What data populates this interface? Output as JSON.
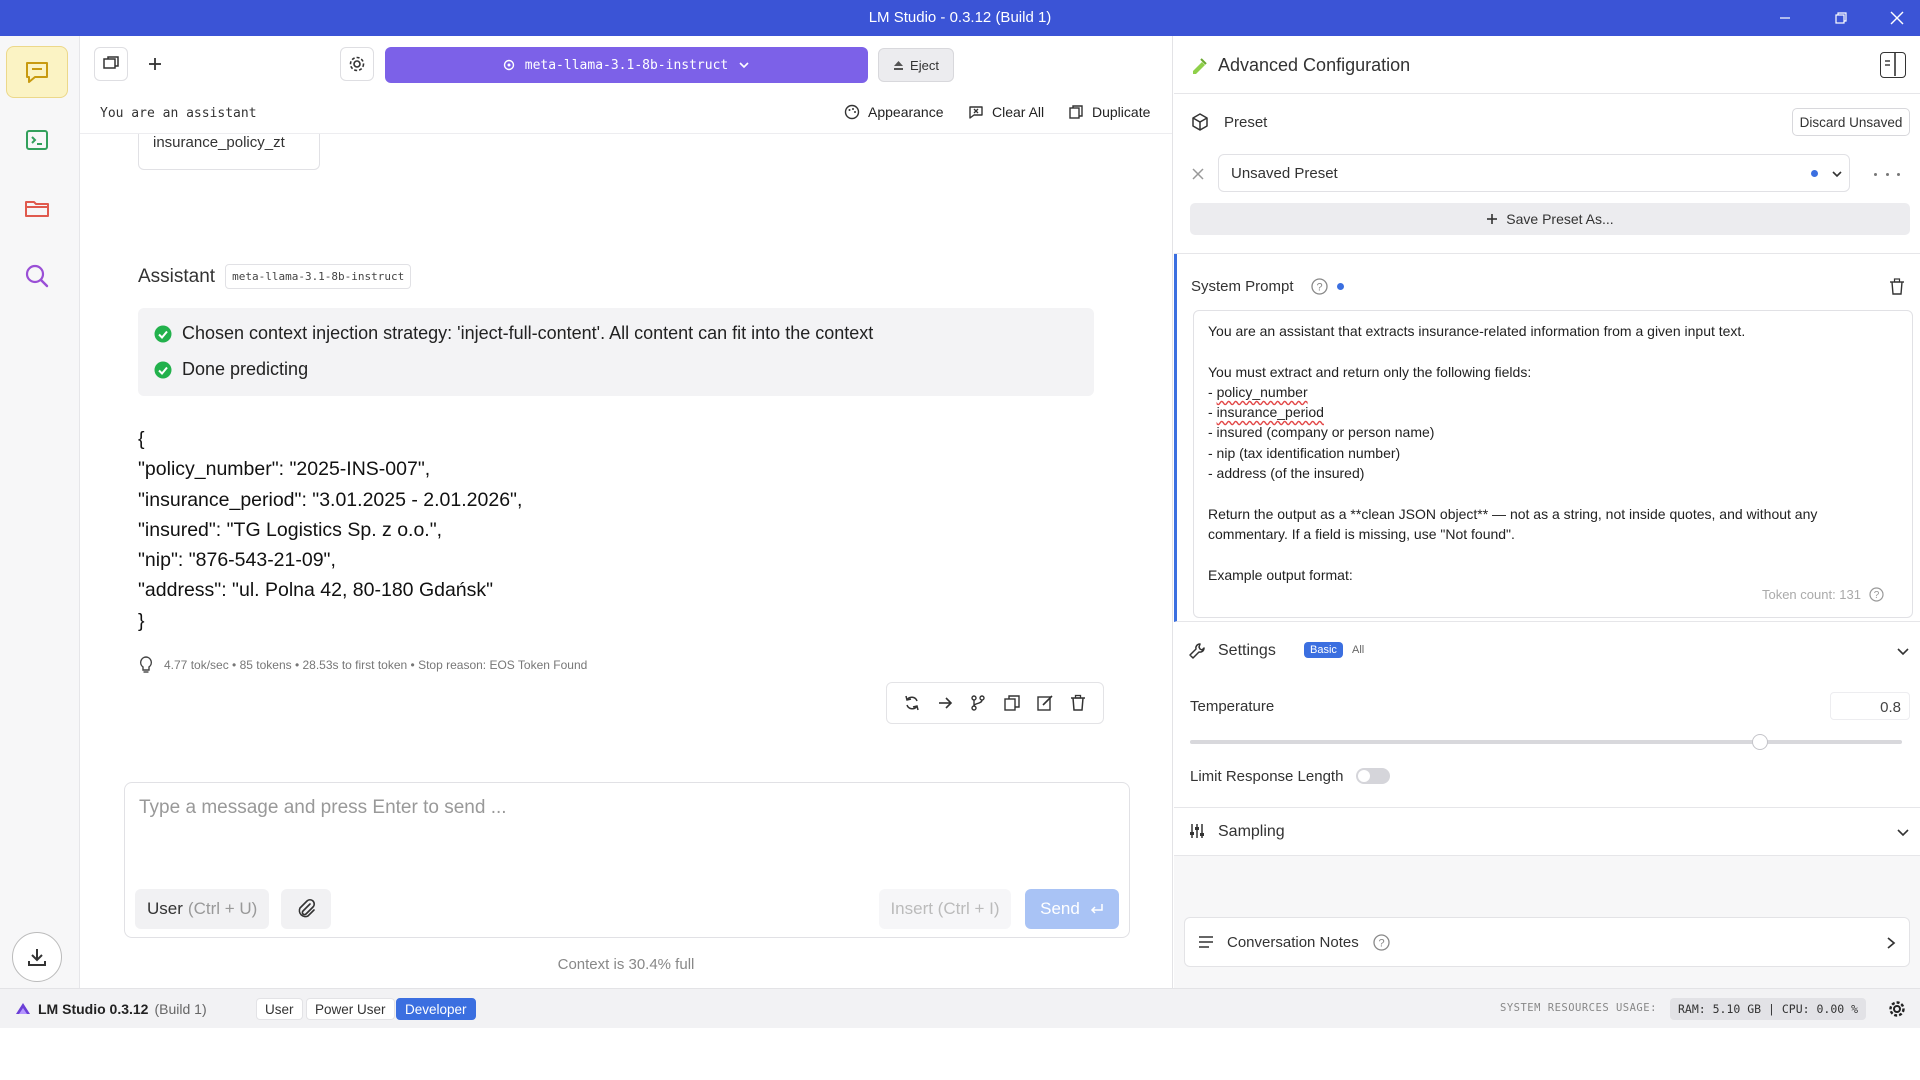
{
  "window": {
    "title": "LM Studio - 0.3.12 (Build 1)"
  },
  "chat": {
    "model": "meta-llama-3.1-8b-instruct",
    "eject_label": "Eject",
    "system_prompt_preview": "You are an assistant",
    "actions": {
      "appearance": "Appearance",
      "clear_all": "Clear All",
      "duplicate": "Duplicate"
    },
    "prev_attachment": "insurance_policy_zt",
    "assistant": {
      "label": "Assistant",
      "model_tag": "meta-llama-3.1-8b-instruct",
      "status": [
        "Chosen context injection strategy: 'inject-full-content'. All content can fit into the context",
        "Done predicting"
      ],
      "output_lines": [
        "{",
        "\"policy_number\": \"2025-INS-007\",",
        "\"insurance_period\": \"3.01.2025 - 2.01.2026\",",
        "\"insured\": \"TG Logistics Sp. z o.o.\",",
        "\"nip\": \"876-543-21-09\",",
        "\"address\": \"ul. Polna 42, 80-180 Gdańsk\"",
        "}"
      ],
      "stats": "4.77 tok/sec • 85 tokens • 28.53s to first token • Stop reason: EOS Token Found"
    },
    "composer": {
      "placeholder": "Type a message and press Enter to send ...",
      "role_label": "User",
      "role_hint": "(Ctrl + U)",
      "insert_label": "Insert (Ctrl + I)",
      "send_label": "Send"
    },
    "context_note": "Context is 30.4% full"
  },
  "config": {
    "title": "Advanced Configuration",
    "preset": {
      "label": "Preset",
      "discard_label": "Discard Unsaved",
      "current": "Unsaved Preset",
      "save_as_label": "Save Preset As..."
    },
    "system_prompt": {
      "label": "System Prompt",
      "lines": [
        "You are an assistant that extracts insurance-related information from a given input text.",
        "",
        "You must extract and return only the following fields:",
        "- policy_number",
        "- insurance_period",
        "- insured (company or person name)",
        "- nip (tax identification number)",
        "- address (of the insured)",
        "",
        "Return the output as a **clean JSON object** — not as a string, not inside quotes, and without any",
        "commentary. If a field is missing, use \"Not found\".",
        "",
        "Example output format:"
      ],
      "token_count": "Token count: 131"
    },
    "settings": {
      "label": "Settings",
      "mode_basic": "Basic",
      "mode_all": "All",
      "temperature_label": "Temperature",
      "temperature_value": "0.8",
      "temperature_fraction": 0.8,
      "limit_label": "Limit Response Length"
    },
    "sampling": {
      "label": "Sampling"
    },
    "conversation_notes": {
      "label": "Conversation Notes"
    }
  },
  "statusbar": {
    "brand": "LM Studio 0.3.12",
    "build": "(Build 1)",
    "modes": [
      "User",
      "Power User",
      "Developer"
    ],
    "active_mode": "Developer",
    "resources_label": "SYSTEM RESOURCES USAGE:",
    "resources_value": "RAM: 5.10 GB | CPU: 0.00 %"
  },
  "colors": {
    "titlebar": "#3b54d6",
    "model_select": "#7c61e8",
    "accent": "#3b6fe0",
    "success": "#22b14c"
  }
}
